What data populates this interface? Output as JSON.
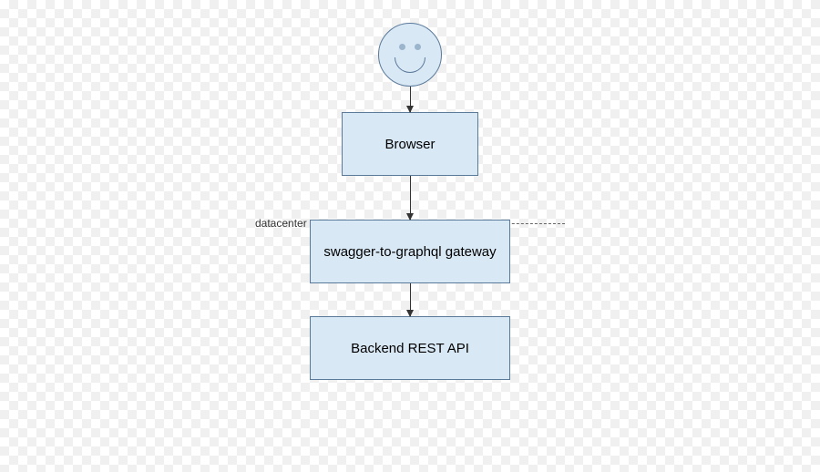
{
  "diagram": {
    "actor": "user",
    "nodes": {
      "browser": "Browser",
      "gateway": "swagger-to-graphql gateway",
      "backend": "Backend REST API"
    },
    "boundary_label": "datacenter",
    "flow": [
      "user",
      "browser",
      "gateway",
      "backend"
    ],
    "boundary_after": "browser"
  }
}
